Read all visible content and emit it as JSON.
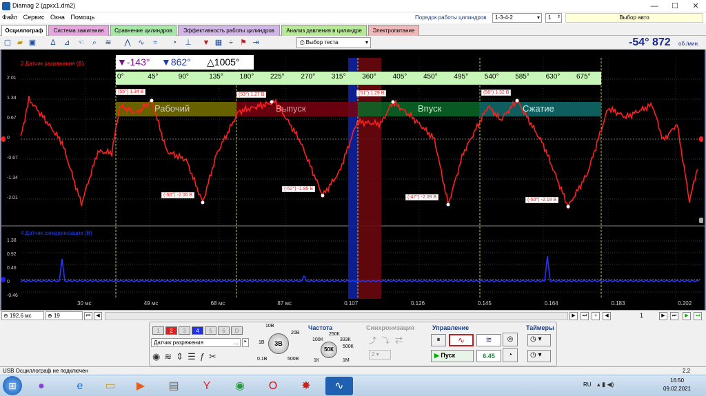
{
  "window": {
    "title": "Diamag 2 (дрхх1.dm2)",
    "minimize": "—",
    "maximize": "☐",
    "close": "✕"
  },
  "menu": [
    "Файл",
    "Сервис",
    "Окна",
    "Помощь"
  ],
  "header": {
    "firing_order_label": "Порядок работы цилиндров",
    "firing_order_value": "1-3-4-2",
    "cyl_value": "1",
    "auto_select": "Выбор авто"
  },
  "tabs": [
    "Осциллограф",
    "Система зажигания",
    "Сравнение цилиндров",
    "Эффективность работы цилиндров",
    "Анализ давления в цилиндре",
    "Электропитание"
  ],
  "toolbar": {
    "test_select": "Выбор теста",
    "rpm_value": "-54° 872",
    "rpm_unit": "об./мин."
  },
  "scope": {
    "ch2_title": "2 Датчик разряжения (В)",
    "ch4_title": "4 Датчик синхронизации (В)",
    "cursor_a": "-143°",
    "cursor_b": "862°",
    "delta": "1005°",
    "ch2_ticks": [
      "2.01",
      "1.34",
      "0.67",
      "0",
      "-0.67",
      "-1.34",
      "-2.01"
    ],
    "ch4_ticks": [
      "1.38",
      "0.92",
      "0.46",
      "0",
      "-0.46"
    ],
    "degree_ticks": [
      "0°",
      "45°",
      "90°",
      "135°",
      "180°",
      "225°",
      "270°",
      "315°",
      "360°",
      "405°",
      "450°",
      "495°",
      "540°",
      "585°",
      "630°",
      "675°"
    ],
    "phases": [
      "Рабочий",
      "Выпуск",
      "Впуск",
      "Сжатие"
    ],
    "time_ticks": [
      "30 мс",
      "49 мс",
      "68 мс",
      "87 мс",
      "0.107",
      "0.126",
      "0.145",
      "0.164",
      "0.183",
      "0.202"
    ],
    "peak_labels": [
      "(55°) 1.34 В",
      "(53°) 1.27 В",
      "(51°) 1.29 В",
      "(56°) 1.32 В"
    ],
    "valley_labels": [
      "(-50°) -2.06 В",
      "(-52°) -1.85 В",
      "(-47°) -2.09 В",
      "(-50°) -2.18 В"
    ]
  },
  "scrollbar": {
    "timebase": "192.6 мс",
    "count": "19",
    "page": "1"
  },
  "panel": {
    "channels": [
      "1",
      "2",
      "3",
      "4",
      "5",
      "6",
      "D"
    ],
    "sensor": "Датчик разряжения",
    "range_labels": [
      "10В",
      "20В",
      "1В",
      "0.1В",
      "500В",
      "3В"
    ],
    "freq_title": "Частота",
    "freq_labels": [
      "250К",
      "100К",
      "333К",
      "500К",
      "1К",
      "1М",
      "50К"
    ],
    "sync_title": "Синхронизация",
    "sync_value": "2",
    "control_title": "Управление",
    "start_label": "Пуск",
    "version": "6.45",
    "timers_title": "Таймеры"
  },
  "status": {
    "left": "USB Осциллограф не подключен",
    "right": "2.2"
  },
  "taskbar": {
    "lang": "RU",
    "time": "16:50",
    "date": "09.02.2021"
  },
  "colors": {
    "ch2": "#ff2020",
    "ch4": "#2020ff",
    "accent": "#1c3c7a"
  }
}
